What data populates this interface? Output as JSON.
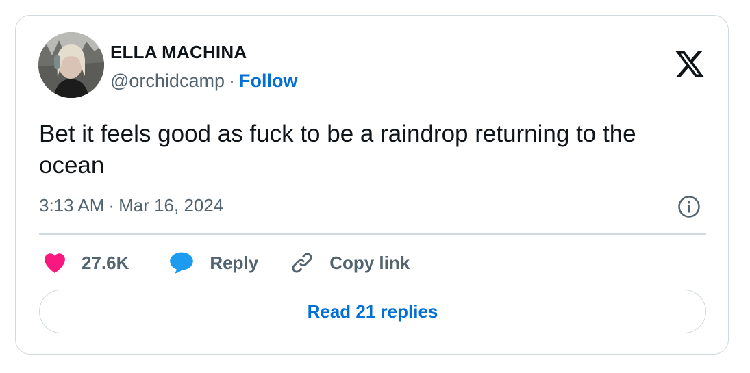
{
  "author": {
    "name": "ELLA MACHINA",
    "handle": "@orchidcamp",
    "separator": "·",
    "follow_label": "Follow"
  },
  "tweet": {
    "text": "Bet it feels good as fuck to be a raindrop returning to the ocean",
    "time": "3:13 AM",
    "separator": "·",
    "date": "Mar 16, 2024"
  },
  "actions": {
    "like_count": "27.6K",
    "reply_label": "Reply",
    "copy_label": "Copy link"
  },
  "read_replies_label": "Read 21 replies",
  "icons": {
    "logo": "x-logo-icon",
    "info": "info-icon",
    "like": "heart-icon",
    "reply": "speech-bubble-icon",
    "copy": "link-icon"
  },
  "colors": {
    "text": "#0f1419",
    "secondary": "#536471",
    "link": "#006fd6",
    "heart": "#f91880",
    "reply_bubble": "#1d9bf0",
    "border": "#cfd9de"
  }
}
